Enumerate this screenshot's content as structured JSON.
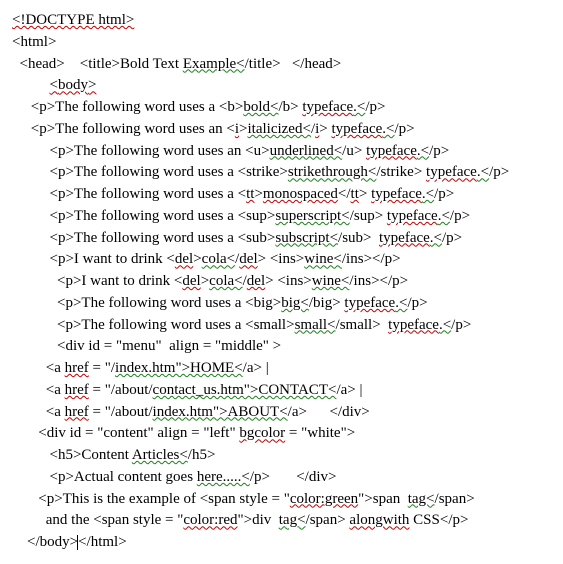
{
  "type": "code-listing",
  "language": "html",
  "title_in_code": "Bold Text Example",
  "lines": [
    {
      "indent": "",
      "parts": [
        {
          "t": "<!DOCTYPE html>",
          "c": "squig"
        }
      ]
    },
    {
      "indent": "",
      "parts": [
        {
          "t": "<html>"
        }
      ]
    },
    {
      "indent": "  ",
      "parts": [
        {
          "t": "<head>    <title>Bold Text "
        },
        {
          "t": "Example<",
          "c": "squig-g"
        },
        {
          "t": "/title>   </head>"
        }
      ]
    },
    {
      "indent": "          ",
      "parts": [
        {
          "t": "<",
          "c": "squig"
        },
        {
          "t": "body",
          "c": "squig"
        },
        {
          "t": ">",
          "c": "squig"
        }
      ]
    },
    {
      "indent": "     ",
      "parts": [
        {
          "t": "<p>The following word uses a <b>"
        },
        {
          "t": "bold<",
          "c": "squig-g"
        },
        {
          "t": "/b> "
        },
        {
          "t": "typeface",
          "c": "squig"
        },
        {
          "t": ".<",
          "c": "squig-g"
        },
        {
          "t": "/p>"
        }
      ]
    },
    {
      "indent": "     ",
      "parts": [
        {
          "t": "<p>The following word uses an <"
        },
        {
          "t": "i",
          "c": "squig"
        },
        {
          "t": ">"
        },
        {
          "t": "italicized<",
          "c": "squig-g"
        },
        {
          "t": "/"
        },
        {
          "t": "i",
          "c": "squig"
        },
        {
          "t": "> "
        },
        {
          "t": "typeface",
          "c": "squig"
        },
        {
          "t": ".<",
          "c": "squig-g"
        },
        {
          "t": "/p>"
        }
      ]
    },
    {
      "indent": "          ",
      "parts": [
        {
          "t": "<p>The following word uses an <u>"
        },
        {
          "t": "underlined<",
          "c": "squig-g"
        },
        {
          "t": "/u> "
        },
        {
          "t": "typeface",
          "c": "squig"
        },
        {
          "t": ".<",
          "c": "squig-g"
        },
        {
          "t": "/p>"
        }
      ]
    },
    {
      "indent": "          ",
      "parts": [
        {
          "t": "<p>The following word uses a <strike>"
        },
        {
          "t": "strikethrough<",
          "c": "squig-g"
        },
        {
          "t": "/strike> "
        },
        {
          "t": "typeface",
          "c": "squig"
        },
        {
          "t": ".<",
          "c": "squig-g"
        },
        {
          "t": "/p>"
        }
      ]
    },
    {
      "indent": "          ",
      "parts": [
        {
          "t": "<p>The following word uses a <"
        },
        {
          "t": "tt",
          "c": "squig"
        },
        {
          "t": ">"
        },
        {
          "t": "monospaced",
          "c": "squig"
        },
        {
          "t": "</"
        },
        {
          "t": "tt",
          "c": "squig"
        },
        {
          "t": "> "
        },
        {
          "t": "typeface",
          "c": "squig"
        },
        {
          "t": ".<",
          "c": "squig-g"
        },
        {
          "t": "/p>"
        }
      ]
    },
    {
      "indent": "          ",
      "parts": [
        {
          "t": "<p>The following word uses a <sup>"
        },
        {
          "t": "superscript<",
          "c": "squig-g"
        },
        {
          "t": "/sup> "
        },
        {
          "t": "typeface",
          "c": "squig"
        },
        {
          "t": ".<",
          "c": "squig-g"
        },
        {
          "t": "/p>"
        }
      ]
    },
    {
      "indent": "          ",
      "parts": [
        {
          "t": "<p>The following word uses a <sub>"
        },
        {
          "t": "subscript<",
          "c": "squig-g"
        },
        {
          "t": "/sub>  "
        },
        {
          "t": "typeface",
          "c": "squig"
        },
        {
          "t": ".<",
          "c": "squig-g"
        },
        {
          "t": "/p>"
        }
      ]
    },
    {
      "indent": "          ",
      "parts": [
        {
          "t": "<p>I want to drink <"
        },
        {
          "t": "del",
          "c": "squig"
        },
        {
          "t": ">"
        },
        {
          "t": "cola<",
          "c": "squig-g"
        },
        {
          "t": "/"
        },
        {
          "t": "del",
          "c": "squig"
        },
        {
          "t": "> <ins>"
        },
        {
          "t": "wine<",
          "c": "squig-g"
        },
        {
          "t": "/ins></p>"
        }
      ]
    },
    {
      "indent": "            ",
      "parts": [
        {
          "t": "<p>I want to drink <"
        },
        {
          "t": "del",
          "c": "squig"
        },
        {
          "t": ">"
        },
        {
          "t": "cola<",
          "c": "squig-g"
        },
        {
          "t": "/"
        },
        {
          "t": "del",
          "c": "squig"
        },
        {
          "t": "> <ins>"
        },
        {
          "t": "wine<",
          "c": "squig-g"
        },
        {
          "t": "/ins></p>"
        }
      ]
    },
    {
      "indent": "            ",
      "parts": [
        {
          "t": "<p>The following word uses a <big>"
        },
        {
          "t": "big<",
          "c": "squig-g"
        },
        {
          "t": "/big> "
        },
        {
          "t": "typeface",
          "c": "squig"
        },
        {
          "t": ".<",
          "c": "squig-g"
        },
        {
          "t": "/p>"
        }
      ]
    },
    {
      "indent": "            ",
      "parts": [
        {
          "t": "<p>The following word uses a <small>"
        },
        {
          "t": "small<",
          "c": "squig-g"
        },
        {
          "t": "/small>  "
        },
        {
          "t": "typeface",
          "c": "squig"
        },
        {
          "t": ".<",
          "c": "squig-g"
        },
        {
          "t": "/p>"
        }
      ]
    },
    {
      "indent": "            ",
      "parts": [
        {
          "t": "<div id = \"menu\"  align = \"middle\" >"
        }
      ]
    },
    {
      "indent": "         ",
      "parts": [
        {
          "t": "<a "
        },
        {
          "t": "href",
          "c": "squig"
        },
        {
          "t": " = \"/"
        },
        {
          "t": "index.htm\">HOME<",
          "c": "squig-g"
        },
        {
          "t": "/a> |"
        }
      ]
    },
    {
      "indent": "         ",
      "parts": [
        {
          "t": "<a "
        },
        {
          "t": "href",
          "c": "squig"
        },
        {
          "t": " = \"/about/"
        },
        {
          "t": "contact_us.htm\">CONTACT<",
          "c": "squig-g"
        },
        {
          "t": "/a> |"
        }
      ]
    },
    {
      "indent": "         ",
      "parts": [
        {
          "t": "<a "
        },
        {
          "t": "href",
          "c": "squig"
        },
        {
          "t": " = \"/about/"
        },
        {
          "t": "index.htm\">ABOUT<",
          "c": "squig-g"
        },
        {
          "t": "/a>      </div>"
        }
      ]
    },
    {
      "indent": "       ",
      "parts": [
        {
          "t": "<div id = \"content\" align = \"left\" "
        },
        {
          "t": "bgcolor",
          "c": "squig"
        },
        {
          "t": " = \"white\">"
        }
      ]
    },
    {
      "indent": "          ",
      "parts": [
        {
          "t": "<h5>Content "
        },
        {
          "t": "Articles<",
          "c": "squig-g"
        },
        {
          "t": "/h5>"
        }
      ]
    },
    {
      "indent": "          ",
      "parts": [
        {
          "t": "<p>Actual content goes "
        },
        {
          "t": "here.....<",
          "c": "squig-g"
        },
        {
          "t": "/p>       </div>"
        }
      ]
    },
    {
      "indent": "       ",
      "parts": [
        {
          "t": "<p>This is the example of <span style = \""
        },
        {
          "t": "color:green",
          "c": "squig"
        },
        {
          "t": "\">span  "
        },
        {
          "t": "tag<",
          "c": "squig-g"
        },
        {
          "t": "/span>"
        }
      ]
    },
    {
      "indent": "         ",
      "parts": [
        {
          "t": "and the <span style = \""
        },
        {
          "t": "color:red",
          "c": "squig"
        },
        {
          "t": "\">div  "
        },
        {
          "t": "tag<",
          "c": "squig-g"
        },
        {
          "t": "/span> "
        },
        {
          "t": "alongwith",
          "c": "squig"
        },
        {
          "t": " CSS</p>"
        }
      ]
    },
    {
      "indent": "    ",
      "parts": [
        {
          "t": "</body>"
        },
        {
          "caret": true
        },
        {
          "t": "</html>"
        }
      ]
    }
  ]
}
